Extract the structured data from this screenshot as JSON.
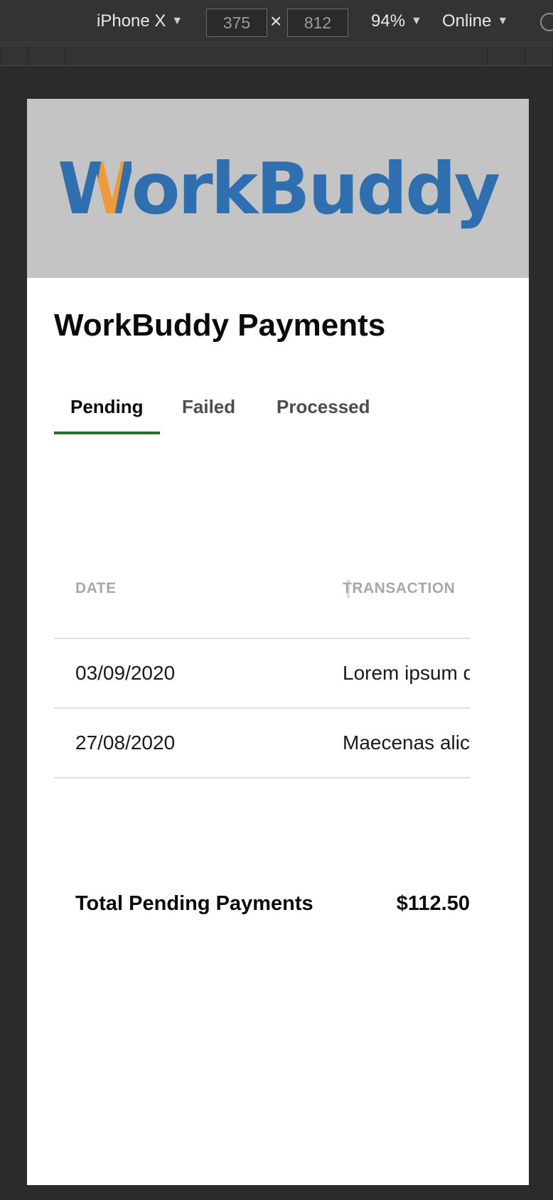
{
  "devtools": {
    "device": "iPhone X",
    "width": "375",
    "height": "812",
    "times": "×",
    "zoom": "94%",
    "network": "Online"
  },
  "app": {
    "logo": {
      "part1": "W",
      "part2": "orkBuddy",
      "color_main": "#2f6faf",
      "color_accent": "#ef9a3a"
    },
    "title": "WorkBuddy Payments",
    "tabs": [
      {
        "label": "Pending",
        "active": true
      },
      {
        "label": "Failed",
        "active": false
      },
      {
        "label": "Processed",
        "active": false
      }
    ],
    "table": {
      "headers": [
        "DATE",
        "TRANSACTION"
      ],
      "rows": [
        {
          "date": "03/09/2020",
          "transaction": "Lorem ipsum d"
        },
        {
          "date": "27/08/2020",
          "transaction": "Maecenas alic"
        }
      ]
    },
    "total": {
      "label": "Total Pending Payments",
      "amount": "$112.50"
    }
  }
}
